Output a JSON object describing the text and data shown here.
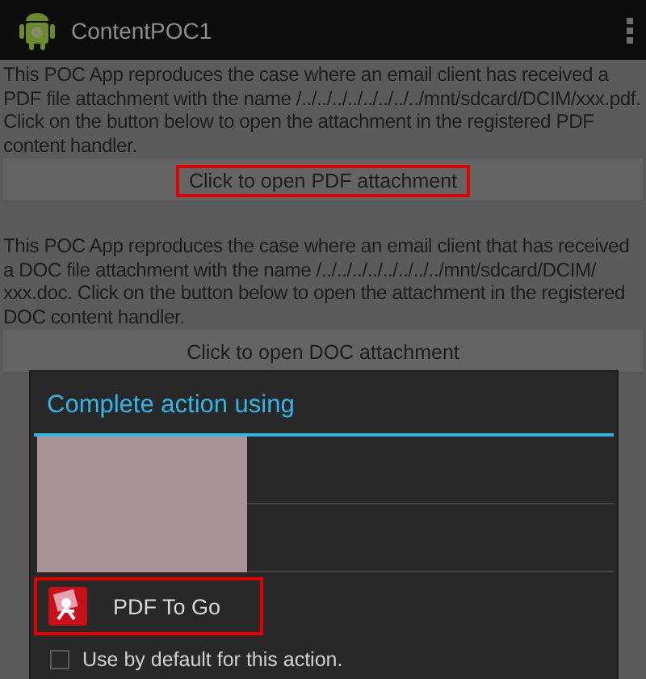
{
  "app_bar": {
    "title": "ContentPOC1"
  },
  "sections": [
    {
      "description": "This POC App reproduces the case where an email client has received a PDF file attachment with the name /../../../../../../../../mnt/sdcard/DCIM/xxx.pdf. Click on the button below to open the attachment in the registered PDF content handler.",
      "button": {
        "label": "Click to open PDF attachment",
        "highlighted": true
      }
    },
    {
      "description": "This POC App reproduces the case where an email client that has received a DOC file attachment with the name /../../../../../../../../mnt/sdcard/DCIM/ xxx.doc. Click on the button below to open the attachment in the registered DOC content handler.",
      "button": {
        "label": "Click to open DOC attachment",
        "highlighted": false
      }
    }
  ],
  "dialog": {
    "title": "Complete action using",
    "options": [
      {
        "kind": "redacted"
      },
      {
        "kind": "redacted"
      },
      {
        "kind": "app",
        "label": "PDF To Go",
        "highlighted": true
      }
    ],
    "default_checkbox": {
      "label": "Use by default for this action.",
      "checked": false
    }
  }
}
